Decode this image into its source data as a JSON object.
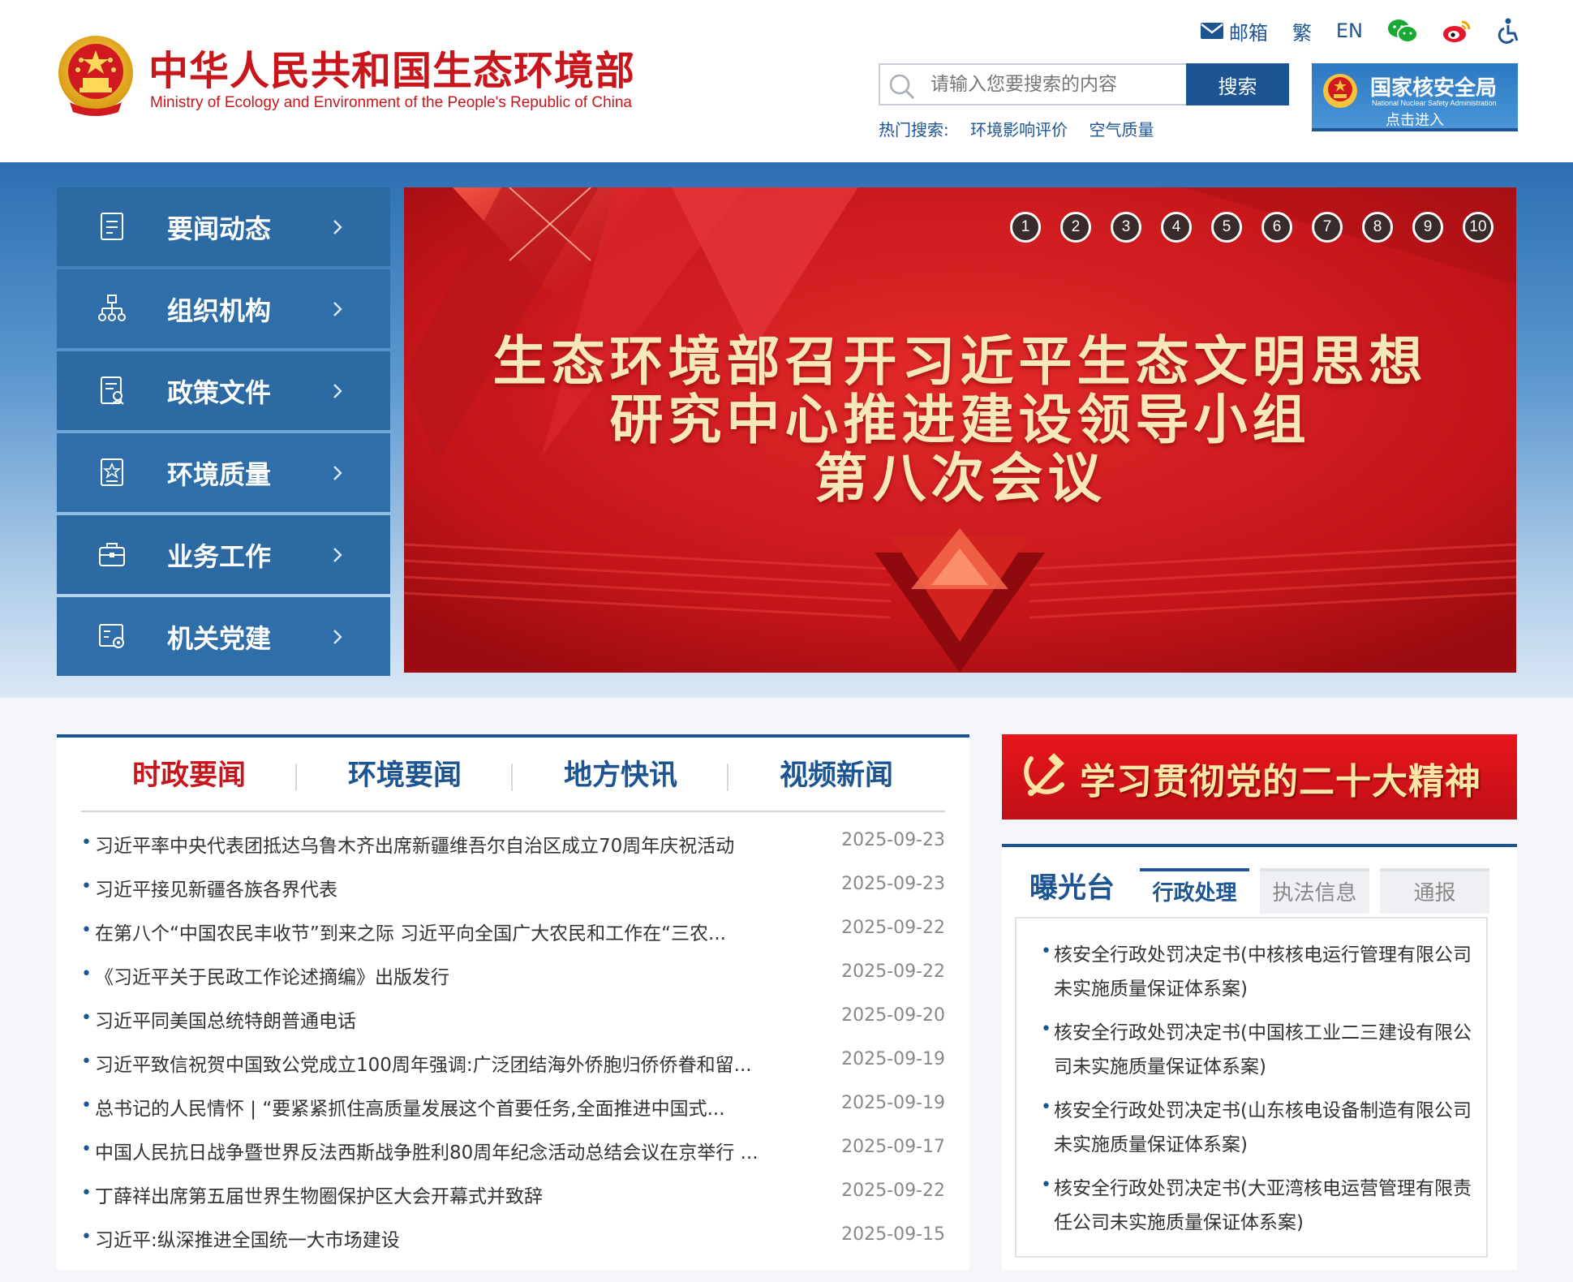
{
  "site": {
    "title_cn": "中华人民共和国生态环境部",
    "title_en": "Ministry of Ecology and Environment of the People's Republic of China"
  },
  "toplinks": {
    "mail": "邮箱",
    "traditional": "繁",
    "english": "EN",
    "wechat_icon": "wechat-icon",
    "weibo_icon": "weibo-icon",
    "accessibility_icon": "accessibility-icon"
  },
  "search": {
    "placeholder": "请输入您要搜索的内容",
    "button": "搜索",
    "hot_label": "热门搜索:",
    "hot_terms": [
      "环境影响评价",
      "空气质量"
    ]
  },
  "nnsa": {
    "title": "国家核安全局",
    "subtitle": "National Nuclear Safety Administration",
    "enter": "点击进入"
  },
  "sidebar": {
    "items": [
      {
        "label": "要闻动态",
        "icon": "news-icon"
      },
      {
        "label": "组织机构",
        "icon": "org-chart-icon"
      },
      {
        "label": "政策文件",
        "icon": "policy-doc-icon"
      },
      {
        "label": "环境质量",
        "icon": "quality-badge-icon"
      },
      {
        "label": "业务工作",
        "icon": "briefcase-icon"
      },
      {
        "label": "机关党建",
        "icon": "party-building-icon"
      }
    ]
  },
  "banner": {
    "lines": [
      "生态环境部召开习近平生态文明思想",
      "研究中心推进建设领导小组",
      "第八次会议"
    ],
    "pages": [
      "1",
      "2",
      "3",
      "4",
      "5",
      "6",
      "7",
      "8",
      "9",
      "10"
    ]
  },
  "news": {
    "tabs": [
      "时政要闻",
      "环境要闻",
      "地方快讯",
      "视频新闻"
    ],
    "items": [
      {
        "title": "习近平率中央代表团抵达乌鲁木齐出席新疆维吾尔自治区成立70周年庆祝活动",
        "date": "2025-09-23"
      },
      {
        "title": "习近平接见新疆各族各界代表",
        "date": "2025-09-23"
      },
      {
        "title": "在第八个“中国农民丰收节”到来之际 习近平向全国广大农民和工作在“三农...",
        "date": "2025-09-22"
      },
      {
        "title": "《习近平关于民政工作论述摘编》出版发行",
        "date": "2025-09-22"
      },
      {
        "title": "习近平同美国总统特朗普通电话",
        "date": "2025-09-20"
      },
      {
        "title": "习近平致信祝贺中国致公党成立100周年强调:广泛团结海外侨胞归侨侨眷和留...",
        "date": "2025-09-19"
      },
      {
        "title": "总书记的人民情怀 | “要紧紧抓住高质量发展这个首要任务,全面推进中国式...",
        "date": "2025-09-19"
      },
      {
        "title": "中国人民抗日战争暨世界反法西斯战争胜利80周年纪念活动总结会议在京举行 ...",
        "date": "2025-09-17"
      },
      {
        "title": "丁薛祥出席第五届世界生物圈保护区大会开幕式并致辞",
        "date": "2025-09-22"
      },
      {
        "title": "习近平:纵深推进全国统一大市场建设",
        "date": "2025-09-15"
      }
    ]
  },
  "study": {
    "text": "学习贯彻党的二十大精神"
  },
  "exposure": {
    "title": "曝光台",
    "tabs": [
      "行政处理",
      "执法信息",
      "通报"
    ],
    "items": [
      "核安全行政处罚决定书(中核核电运行管理有限公司未实施质量保证体系案)",
      "核安全行政处罚决定书(中国核工业二三建设有限公司未实施质量保证体系案)",
      "核安全行政处罚决定书(山东核电设备制造有限公司未实施质量保证体系案)",
      "核安全行政处罚决定书(大亚湾核电运营管理有限责任公司未实施质量保证体系案)"
    ]
  },
  "colors": {
    "brand_red": "#c8161d",
    "brand_blue": "#1d5592",
    "sidebar_blue": "#2f6ea8",
    "banner_red": "#c8181c"
  }
}
